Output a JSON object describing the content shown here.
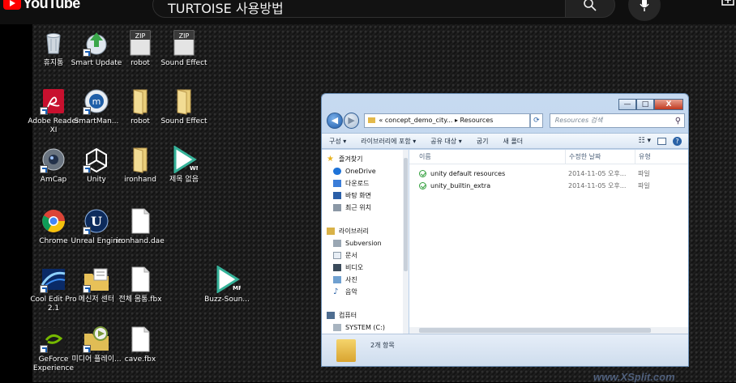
{
  "youtube": {
    "logo_text": "YouTube",
    "search_value": "TURTOISE 사용방법"
  },
  "desktop_icons": [
    {
      "label": "휴지통",
      "icon": "recycle-bin-icon"
    },
    {
      "label": "Smart Update",
      "icon": "smart-update-icon"
    },
    {
      "label": "robot",
      "icon": "zip-icon",
      "badge": "ZIP"
    },
    {
      "label": "Sound Effect",
      "icon": "zip-icon",
      "badge": "ZIP"
    },
    {
      "label": "Adobe Reader XI",
      "icon": "adobe-reader-icon"
    },
    {
      "label": "SmartMan...",
      "icon": "smartman-icon"
    },
    {
      "label": "robot",
      "icon": "folder-icon"
    },
    {
      "label": "Sound Effect",
      "icon": "folder-icon"
    },
    {
      "label": "AmCap",
      "icon": "amcap-icon"
    },
    {
      "label": "Unity",
      "icon": "unity-icon"
    },
    {
      "label": "ironhand",
      "icon": "folder-icon"
    },
    {
      "label": "제목 없음",
      "icon": "wma-file-icon",
      "badge": "WMA"
    },
    {
      "label": "Chrome",
      "icon": "chrome-icon"
    },
    {
      "label": "Unreal Engine",
      "icon": "unreal-engine-icon"
    },
    {
      "label": "ironhand.dae",
      "icon": "file-icon"
    },
    {
      "label": "Cool Edit Pro 2.1",
      "icon": "cool-edit-icon"
    },
    {
      "label": "메신저 센터",
      "icon": "messenger-icon"
    },
    {
      "label": "전체 몸통.fbx",
      "icon": "file-icon"
    },
    {
      "label": "Buzz-Soun...",
      "icon": "mp3-file-icon",
      "badge": "MP3"
    },
    {
      "label": "GeForce Experience",
      "icon": "geforce-icon"
    },
    {
      "label": "미디어 플레이...",
      "icon": "media-player-icon"
    },
    {
      "label": "cave.fbx",
      "icon": "file-icon"
    }
  ],
  "explorer": {
    "controls": {
      "min": "—",
      "max": "□",
      "close": "X"
    },
    "address": {
      "prefix": "«",
      "path1": "concept_demo_city...",
      "sep": "▸",
      "path2": "Resources"
    },
    "search_placeholder": "Resources 검색",
    "toolbar": {
      "organize": "구성 ▾",
      "include_library": "라이브러리에 포함 ▾",
      "share": "공유 대상 ▾",
      "burn": "굽기",
      "new_folder": "새 폴더"
    },
    "nav": {
      "favorites": "즐겨찾기",
      "onedrive": "OneDrive",
      "downloads": "다운로드",
      "desktop": "바탕 화면",
      "recent": "최근 위치",
      "libraries": "라이브러리",
      "subversion": "Subversion",
      "documents": "문서",
      "videos": "비디오",
      "pictures": "사진",
      "music": "음악",
      "computer": "컴퓨터",
      "system_c": "SYSTEM (C:)"
    },
    "columns": {
      "name": "이름",
      "modified": "수정한 날짜",
      "type": "유형"
    },
    "files": [
      {
        "name": "unity default resources",
        "modified": "2014-11-05 오후...",
        "type": "파일"
      },
      {
        "name": "unity_builtin_extra",
        "modified": "2014-11-05 오후...",
        "type": "파일"
      }
    ],
    "status": "2개 항목"
  },
  "watermark": "www.XSplit.com"
}
